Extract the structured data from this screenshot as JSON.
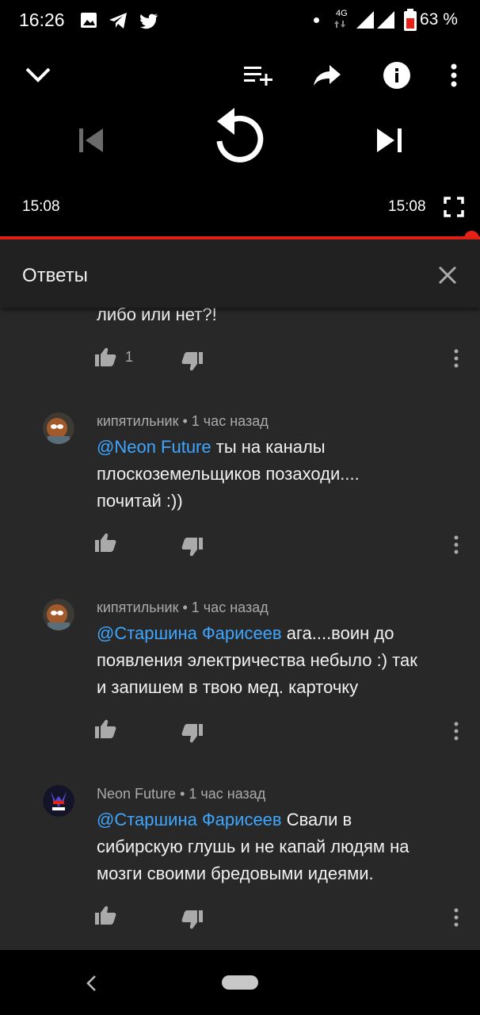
{
  "status_bar": {
    "time": "16:26",
    "network": "4G",
    "battery": "63 %"
  },
  "player": {
    "current_time": "15:08",
    "duration": "15:08",
    "progress": 1.0
  },
  "panel": {
    "title": "Ответы"
  },
  "comments": [
    {
      "text_tail": "либо или нет?!",
      "likes": "1"
    },
    {
      "author": "кипятильник",
      "time": "1 час назад",
      "mention": "@Neon Future",
      "line1": " ты на каналы",
      "line2": "плоскоземельщиков позаходи....",
      "line3": "почитай :))"
    },
    {
      "author": "кипятильник",
      "time": "1 час назад",
      "mention": "@Старшина Фарисеев",
      "line1": " ага....воин до",
      "line2": "появления электричества небыло :) так",
      "line3": "и запишем в твою мед. карточку"
    },
    {
      "author": "Neon Future",
      "time": "1 час назад",
      "mention": "@Старшина Фарисеев",
      "line1": " Свали в",
      "line2": "сибирскую глушь и не капай людям на",
      "line3": "мозги своими бредовыми идеями."
    }
  ],
  "separator": " • ",
  "colors": {
    "accent_red": "#e62117",
    "mention_blue": "#3ea6ff",
    "sheet_bg": "#282828"
  }
}
